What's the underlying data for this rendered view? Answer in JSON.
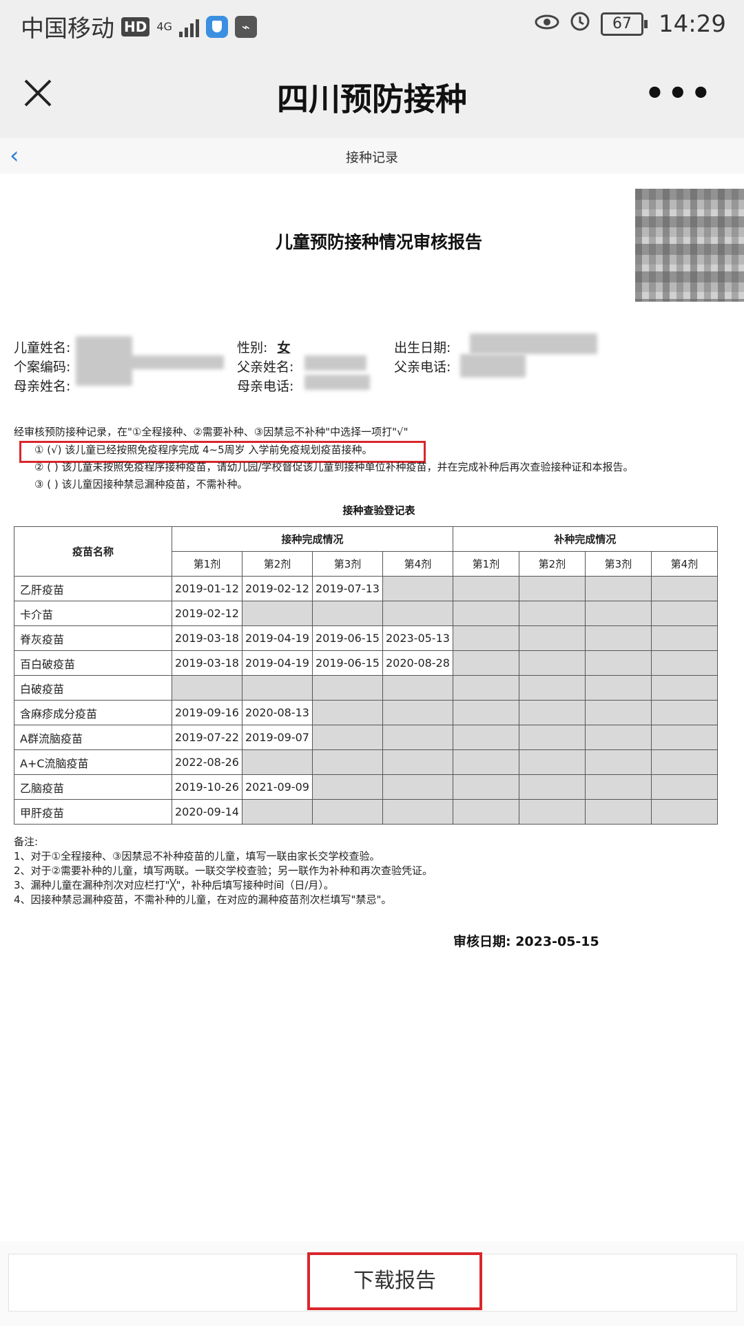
{
  "status_bar": {
    "carrier": "中国移动",
    "hd": "HD",
    "network": "4G",
    "battery": "67",
    "time": "14:29"
  },
  "app_bar": {
    "title": "四川预防接种",
    "more": "•••"
  },
  "sub_nav": {
    "title": "接种记录"
  },
  "report": {
    "title": "儿童预防接种情况审核报告",
    "fields": {
      "child_name_label": "儿童姓名:",
      "case_code_label": "个案编码:",
      "mother_name_label": "母亲姓名:",
      "gender_label": "性别:",
      "gender_value": "女",
      "father_name_label": "父亲姓名:",
      "mother_phone_label": "母亲电话:",
      "birth_date_label": "出生日期:",
      "father_phone_label": "父亲电话:"
    },
    "intro": "经审核预防接种记录，在\"①全程接种、②需要补种、③因禁忌不补种\"中选择一项打\"√\"",
    "options": [
      "①  (√)  该儿童已经按照免疫程序完成 4~5周岁 入学前免疫规划疫苗接种。",
      "②  (  )  该儿童未按照免疫程序接种疫苗，请幼儿园/学校督促该儿童到接种单位补种疫苗，并在完成补种后再次查验接种证和本报告。",
      "③  (  )  该儿童因接种禁忌漏种疫苗，不需补种。"
    ],
    "table_title": "接种查验登记表",
    "table": {
      "col_vaccine": "疫苗名称",
      "group_done": "接种完成情况",
      "group_makeup": "补种完成情况",
      "doses": [
        "第1剂",
        "第2剂",
        "第3剂",
        "第4剂"
      ],
      "rows": [
        {
          "name": "乙肝疫苗",
          "dates": [
            "2019-01-12",
            "2019-02-12",
            "2019-07-13",
            ""
          ],
          "filled": 3
        },
        {
          "name": "卡介苗",
          "dates": [
            "2019-02-12",
            "",
            "",
            ""
          ],
          "filled": 1
        },
        {
          "name": "脊灰疫苗",
          "dates": [
            "2019-03-18",
            "2019-04-19",
            "2019-06-15",
            "2023-05-13"
          ],
          "filled": 4
        },
        {
          "name": "百白破疫苗",
          "dates": [
            "2019-03-18",
            "2019-04-19",
            "2019-06-15",
            "2020-08-28"
          ],
          "filled": 4
        },
        {
          "name": "白破疫苗",
          "dates": [
            "",
            "",
            "",
            ""
          ],
          "filled": 0
        },
        {
          "name": "含麻疹成分疫苗",
          "dates": [
            "2019-09-16",
            "2020-08-13",
            "",
            ""
          ],
          "filled": 2
        },
        {
          "name": "A群流脑疫苗",
          "dates": [
            "2019-07-22",
            "2019-09-07",
            "",
            ""
          ],
          "filled": 2
        },
        {
          "name": "A+C流脑疫苗",
          "dates": [
            "2022-08-26",
            "",
            "",
            ""
          ],
          "filled": 1
        },
        {
          "name": "乙脑疫苗",
          "dates": [
            "2019-10-26",
            "2021-09-09",
            "",
            ""
          ],
          "filled": 2
        },
        {
          "name": "甲肝疫苗",
          "dates": [
            "2020-09-14",
            "",
            "",
            ""
          ],
          "filled": 1
        }
      ]
    },
    "notes": [
      "备注:",
      "1、对于①全程接种、③因禁忌不补种疫苗的儿童，填写一联由家长交学校查验。",
      "2、对于②需要补种的儿童，填写两联。一联交学校查验；另一联作为补种和再次查验凭证。",
      "3、漏种儿童在漏种剂次对应栏打\"╳\"，补种后填写接种时间（日/月）。",
      "4、因接种禁忌漏种疫苗，不需补种的儿童，在对应的漏种疫苗剂次栏填写\"禁忌\"。"
    ],
    "audit_date": "审核日期:  2023-05-15"
  },
  "download_button": "下载报告"
}
